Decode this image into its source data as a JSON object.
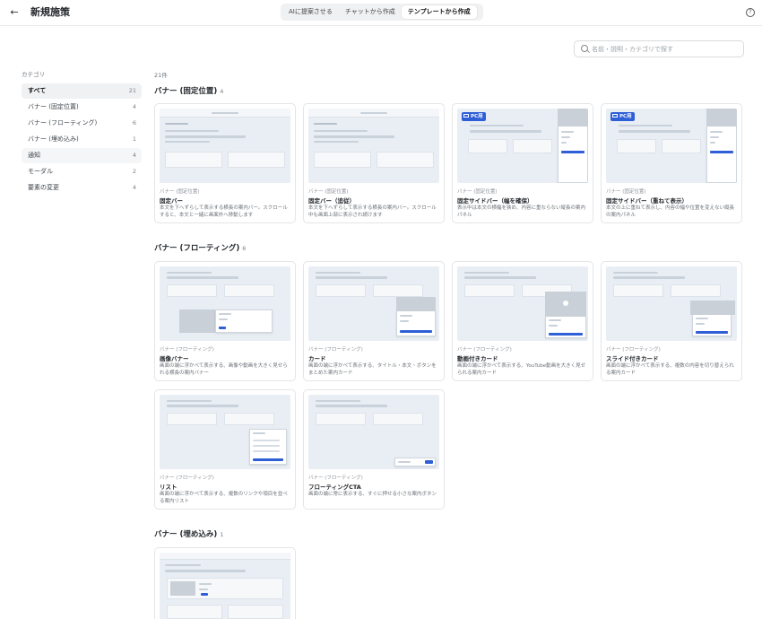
{
  "header": {
    "back_icon": "←",
    "title": "新規施策",
    "tabs": [
      "AIに提案させる",
      "チャットから作成",
      "テンプレートから作成"
    ],
    "active_tab": 2,
    "help_icon": "?"
  },
  "search": {
    "placeholder": "名前・説明・カテゴリで探す"
  },
  "sidebar": {
    "heading": "カテゴリ",
    "items": [
      {
        "label": "すべて",
        "count": "21"
      },
      {
        "label": "バナー (固定位置)",
        "count": "4"
      },
      {
        "label": "バナー (フローティング)",
        "count": "6"
      },
      {
        "label": "バナー (埋め込み)",
        "count": "1"
      },
      {
        "label": "通知",
        "count": "4"
      },
      {
        "label": "モーダル",
        "count": "2"
      },
      {
        "label": "要素の変更",
        "count": "4"
      }
    ]
  },
  "results": {
    "count_label": "21件"
  },
  "sections": [
    {
      "title": "バナー (固定位置)",
      "count": "4",
      "cards": [
        {
          "category": "バナー (固定位置)",
          "name": "固定バー",
          "desc": "本文を下へずらして表示する横長の案内バー。スクロールすると、本文と一緒に画面外へ移動します"
        },
        {
          "category": "バナー (固定位置)",
          "name": "固定バー（追従）",
          "desc": "本文を下へずらして表示する横長の案内バー。スクロール中も画面上部に表示され続けます"
        },
        {
          "category": "バナー (固定位置)",
          "name": "固定サイドバー（幅を確保）",
          "desc": "表示中は本文の横幅を狭め、内容に重ならない縦長の案内パネル",
          "badge": "PC用"
        },
        {
          "category": "バナー (固定位置)",
          "name": "固定サイドバー（重ねて表示）",
          "desc": "本文の上に重ねて表示し、内容の幅や位置を変えない縦長の案内パネル",
          "badge": "PC用"
        }
      ]
    },
    {
      "title": "バナー (フローティング)",
      "count": "6",
      "cards": [
        {
          "category": "バナー (フローティング)",
          "name": "画像バナー",
          "desc": "画面の端に浮かべて表示する、画像や動画を大きく見せられる横長の案内バナー"
        },
        {
          "category": "バナー (フローティング)",
          "name": "カード",
          "desc": "画面の端に浮かべて表示する、タイトル・本文・ボタンをまとめた案内カード"
        },
        {
          "category": "バナー (フローティング)",
          "name": "動画付きカード",
          "desc": "画面の端に浮かべて表示する、YouTube動画を大きく見せられる案内カード"
        },
        {
          "category": "バナー (フローティング)",
          "name": "スライド付きカード",
          "desc": "画面の端に浮かべて表示する、複数の内容を切り替えられる案内カード"
        },
        {
          "category": "バナー (フローティング)",
          "name": "リスト",
          "desc": "画面の端に浮かべて表示する、複数のリンクや項目を並べる案内リスト"
        },
        {
          "category": "バナー (フローティング)",
          "name": "フローティングCTA",
          "desc": "画面の端に常に表示する、すぐに押せる小さな案内ボタン"
        }
      ]
    },
    {
      "title": "バナー (埋め込み)",
      "count": "1",
      "cards": []
    }
  ],
  "colors": {
    "accent": "#2f5fd6",
    "thumb_bg": "#e9eef4",
    "active_bg": "#f0f1f3"
  }
}
